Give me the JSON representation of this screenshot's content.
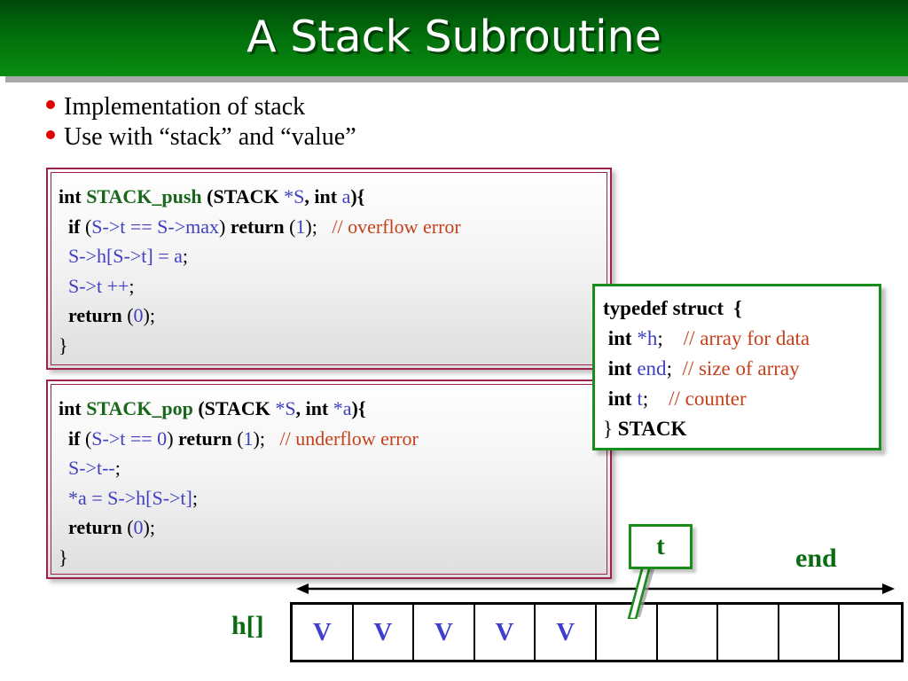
{
  "slide": {
    "title": "A Stack Subroutine",
    "bullets": [
      "Implementation of stack",
      "Use with “stack” and “value”"
    ]
  },
  "colors": {
    "title_bar_top": "#00490a",
    "title_bar_bottom": "#0a8d10",
    "title_text": "#ffffff",
    "bullet_dot": "#e00000",
    "code_border": "#9c2050",
    "typedef_border": "#1a8c1a",
    "keyword": "#000000",
    "function_name": "#18671b",
    "variable": "#4040c0",
    "comment": "#c4411b",
    "diagram_green": "#0a6b12",
    "cell_value": "#3f3fcf"
  },
  "code_push": {
    "lines": [
      [
        {
          "t": "int ",
          "c": "kw"
        },
        {
          "t": "STACK_push",
          "c": "fn"
        },
        {
          "t": " (",
          "c": "kw"
        },
        {
          "t": "STACK",
          "c": "kw"
        },
        {
          "t": " *S",
          "c": "var"
        },
        {
          "t": ", ",
          "c": "kw"
        },
        {
          "t": "int ",
          "c": "kw"
        },
        {
          "t": "a",
          "c": "var"
        },
        {
          "t": "){",
          "c": "kw"
        }
      ],
      [
        {
          "t": "  if ",
          "c": "kw"
        },
        {
          "t": "(",
          "c": "plain"
        },
        {
          "t": "S->t == S->max",
          "c": "var"
        },
        {
          "t": ") ",
          "c": "plain"
        },
        {
          "t": "return ",
          "c": "kw"
        },
        {
          "t": "(",
          "c": "plain"
        },
        {
          "t": "1",
          "c": "num"
        },
        {
          "t": ");   ",
          "c": "plain"
        },
        {
          "t": "// overflow error",
          "c": "cmt"
        }
      ],
      [
        {
          "t": "  ",
          "c": "plain"
        },
        {
          "t": "S->h[S->t] = a",
          "c": "var"
        },
        {
          "t": ";",
          "c": "plain"
        }
      ],
      [
        {
          "t": "  ",
          "c": "plain"
        },
        {
          "t": "S->t ++",
          "c": "var"
        },
        {
          "t": ";",
          "c": "plain"
        }
      ],
      [
        {
          "t": "  return ",
          "c": "kw"
        },
        {
          "t": "(",
          "c": "plain"
        },
        {
          "t": "0",
          "c": "num"
        },
        {
          "t": ");",
          "c": "plain"
        }
      ],
      [
        {
          "t": "}",
          "c": "plain"
        }
      ]
    ]
  },
  "code_pop": {
    "lines": [
      [
        {
          "t": "int ",
          "c": "kw"
        },
        {
          "t": "STACK_pop",
          "c": "fn"
        },
        {
          "t": " (",
          "c": "kw"
        },
        {
          "t": "STACK",
          "c": "kw"
        },
        {
          "t": " *S",
          "c": "var"
        },
        {
          "t": ", ",
          "c": "kw"
        },
        {
          "t": "int ",
          "c": "kw"
        },
        {
          "t": "*a",
          "c": "var"
        },
        {
          "t": "){",
          "c": "kw"
        }
      ],
      [
        {
          "t": "  if ",
          "c": "kw"
        },
        {
          "t": "(",
          "c": "plain"
        },
        {
          "t": "S->t == 0",
          "c": "var"
        },
        {
          "t": ") ",
          "c": "plain"
        },
        {
          "t": "return ",
          "c": "kw"
        },
        {
          "t": "(",
          "c": "plain"
        },
        {
          "t": "1",
          "c": "num"
        },
        {
          "t": ");   ",
          "c": "plain"
        },
        {
          "t": "// underflow error",
          "c": "cmt"
        }
      ],
      [
        {
          "t": "  ",
          "c": "plain"
        },
        {
          "t": "S->t--",
          "c": "var"
        },
        {
          "t": ";",
          "c": "plain"
        }
      ],
      [
        {
          "t": "  ",
          "c": "plain"
        },
        {
          "t": "*a = S->h[S->t]",
          "c": "var"
        },
        {
          "t": ";",
          "c": "plain"
        }
      ],
      [
        {
          "t": "  return ",
          "c": "kw"
        },
        {
          "t": "(",
          "c": "plain"
        },
        {
          "t": "0",
          "c": "num"
        },
        {
          "t": ");",
          "c": "plain"
        }
      ],
      [
        {
          "t": "}",
          "c": "plain"
        }
      ]
    ]
  },
  "code_typedef": {
    "lines": [
      [
        {
          "t": "typedef struct  {",
          "c": "kw"
        }
      ],
      [
        {
          "t": " int ",
          "c": "kw"
        },
        {
          "t": "*h",
          "c": "var"
        },
        {
          "t": ";    ",
          "c": "plain"
        },
        {
          "t": "// array for data",
          "c": "cmt"
        }
      ],
      [
        {
          "t": " int ",
          "c": "kw"
        },
        {
          "t": "end",
          "c": "var"
        },
        {
          "t": ";  ",
          "c": "plain"
        },
        {
          "t": "// size of array",
          "c": "cmt"
        }
      ],
      [
        {
          "t": " int ",
          "c": "kw"
        },
        {
          "t": "t",
          "c": "var"
        },
        {
          "t": ";    ",
          "c": "plain"
        },
        {
          "t": "// counter",
          "c": "cmt"
        }
      ],
      [
        {
          "t": "} ",
          "c": "plain"
        },
        {
          "t": "STACK",
          "c": "kw"
        }
      ]
    ]
  },
  "diagram": {
    "array_label": "h[]",
    "end_label": "end",
    "counter_label": "t",
    "cell_count": 10,
    "filled_count": 5,
    "cell_value": "V",
    "cells": [
      "V",
      "V",
      "V",
      "V",
      "V",
      "",
      "",
      "",
      "",
      ""
    ]
  }
}
